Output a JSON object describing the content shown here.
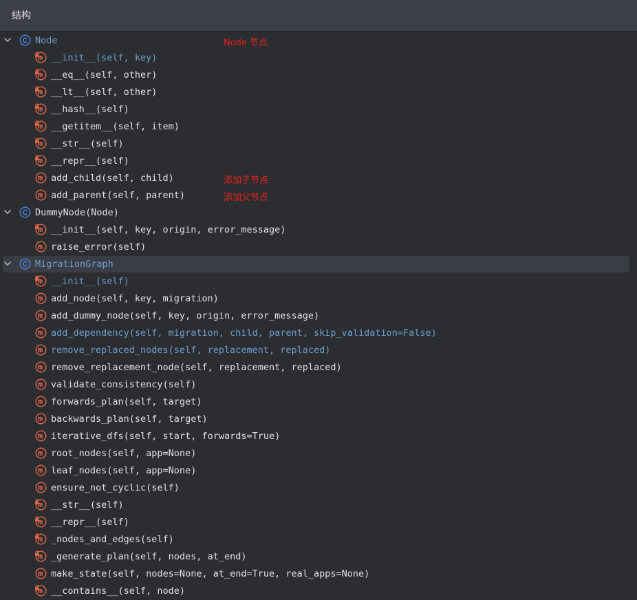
{
  "panel": {
    "title": "结构"
  },
  "tree": [
    {
      "kind": "class",
      "label": "Node",
      "highlight": true,
      "expanded": true,
      "note": "Node 节点"
    },
    {
      "kind": "method",
      "lock": true,
      "label": "__init__(self, key)",
      "highlight": true
    },
    {
      "kind": "method",
      "lock": true,
      "label": "__eq__(self, other)"
    },
    {
      "kind": "method",
      "lock": true,
      "label": "__lt__(self, other)"
    },
    {
      "kind": "method",
      "lock": true,
      "label": "__hash__(self)"
    },
    {
      "kind": "method",
      "lock": true,
      "label": "__getitem__(self, item)"
    },
    {
      "kind": "method",
      "lock": true,
      "label": "__str__(self)"
    },
    {
      "kind": "method",
      "lock": true,
      "label": "__repr__(self)"
    },
    {
      "kind": "method",
      "lock": false,
      "label": "add_child(self, child)",
      "note": "添加子节点"
    },
    {
      "kind": "method",
      "lock": false,
      "label": "add_parent(self, parent)",
      "note": "添加父节点"
    },
    {
      "kind": "class",
      "label": "DummyNode(Node)",
      "expanded": true
    },
    {
      "kind": "method",
      "lock": true,
      "label": "__init__(self, key, origin, error_message)"
    },
    {
      "kind": "method",
      "lock": false,
      "label": "raise_error(self)"
    },
    {
      "kind": "class",
      "label": "MigrationGraph",
      "highlight": true,
      "expanded": true,
      "selected": true
    },
    {
      "kind": "method",
      "lock": true,
      "label": "__init__(self)",
      "highlight": true
    },
    {
      "kind": "method",
      "lock": false,
      "label": "add_node(self, key, migration)"
    },
    {
      "kind": "method",
      "lock": false,
      "label": "add_dummy_node(self, key, origin, error_message)"
    },
    {
      "kind": "method",
      "lock": false,
      "label": "add_dependency(self, migration, child, parent, skip_validation=False)",
      "highlight": true
    },
    {
      "kind": "method",
      "lock": false,
      "label": "remove_replaced_nodes(self, replacement, replaced)",
      "highlight": true
    },
    {
      "kind": "method",
      "lock": false,
      "label": "remove_replacement_node(self, replacement, replaced)"
    },
    {
      "kind": "method",
      "lock": false,
      "label": "validate_consistency(self)"
    },
    {
      "kind": "method",
      "lock": false,
      "label": "forwards_plan(self, target)"
    },
    {
      "kind": "method",
      "lock": false,
      "label": "backwards_plan(self, target)"
    },
    {
      "kind": "method",
      "lock": false,
      "label": "iterative_dfs(self, start, forwards=True)"
    },
    {
      "kind": "method",
      "lock": false,
      "label": "root_nodes(self, app=None)"
    },
    {
      "kind": "method",
      "lock": false,
      "label": "leaf_nodes(self, app=None)"
    },
    {
      "kind": "method",
      "lock": false,
      "label": "ensure_not_cyclic(self)"
    },
    {
      "kind": "method",
      "lock": true,
      "label": "__str__(self)"
    },
    {
      "kind": "method",
      "lock": true,
      "label": "__repr__(self)"
    },
    {
      "kind": "method",
      "lock": true,
      "label": "_nodes_and_edges(self)"
    },
    {
      "kind": "method",
      "lock": true,
      "label": "_generate_plan(self, nodes, at_end)"
    },
    {
      "kind": "method",
      "lock": false,
      "label": "make_state(self, nodes=None, at_end=True, real_apps=None)"
    },
    {
      "kind": "method",
      "lock": true,
      "label": "__contains__(self, node)"
    }
  ],
  "colors": {
    "background": "#2b2d30",
    "header": "#3c3f45",
    "text": "#dfe1e5",
    "highlight_text": "#6e9fcf",
    "class_icon": "#4b86e3",
    "method_icon": "#e8684a",
    "annotation": "#e8231e",
    "selection": "#3a3d43"
  },
  "icons": {
    "class": "class-c-icon",
    "method": "method-m-icon",
    "lock_badge": "lock-badge-icon",
    "expand": "chevron-down-icon"
  }
}
